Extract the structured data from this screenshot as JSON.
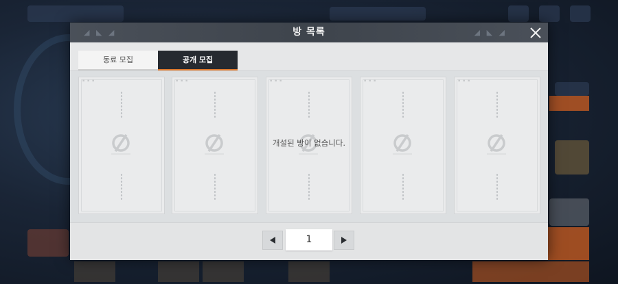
{
  "dialog": {
    "title": "방 목록",
    "close_icon": "close-icon"
  },
  "tabs": [
    {
      "label": "동료 모집",
      "active": false
    },
    {
      "label": "공개 모집",
      "active": true
    }
  ],
  "room_slots": [
    {
      "state": "empty",
      "icon": "empty-slot-icon"
    },
    {
      "state": "empty",
      "icon": "empty-slot-icon"
    },
    {
      "state": "empty",
      "icon": "empty-slot-icon"
    },
    {
      "state": "empty",
      "icon": "empty-slot-icon"
    },
    {
      "state": "empty",
      "icon": "empty-slot-icon"
    }
  ],
  "empty_message": "개설된 방이 없습니다.",
  "pagination": {
    "current_page": "1",
    "prev_icon": "triangle-left-icon",
    "next_icon": "triangle-right-icon"
  },
  "colors": {
    "header": "#3e444c",
    "active_tab": "#262a30",
    "accent": "#e07a2c",
    "panel": "#e6e7e8"
  }
}
